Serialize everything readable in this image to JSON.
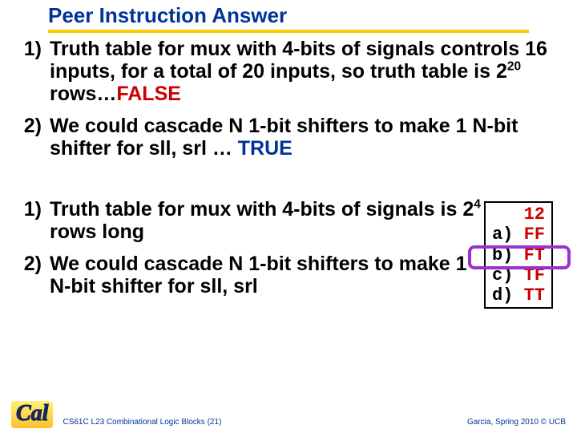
{
  "title": "Peer Instruction Answer",
  "top_bullets": [
    {
      "num": "1)",
      "pre": "Truth table for mux with 4-bits of signals controls 16 inputs, for a total of 20 inputs, so truth table is 2",
      "sup": "20",
      "post": " rows…",
      "verdict": "FALSE",
      "verdict_class": "red"
    },
    {
      "num": "2)",
      "pre": "We could cascade N 1-bit shifters to make 1 N-bit shifter for sll, srl … ",
      "sup": "",
      "post": "",
      "verdict": "TRUE",
      "verdict_class": "blue"
    }
  ],
  "lower_bullets": [
    {
      "num": "1)",
      "pre": "Truth table for mux with 4-bits of signals is 2",
      "sup": "4",
      "post": " rows long"
    },
    {
      "num": "2)",
      "pre": "We could cascade N 1-bit shifters to make 1 N-bit shifter for sll, srl",
      "sup": "",
      "post": ""
    }
  ],
  "answers": {
    "header": "   12",
    "rows": [
      {
        "label": "a)",
        "val": " FF"
      },
      {
        "label": "b)",
        "val": " FT"
      },
      {
        "label": "c)",
        "val": " TF"
      },
      {
        "label": "d)",
        "val": " TT"
      }
    ],
    "correct_index": 1
  },
  "footer": {
    "logo_text": "Cal",
    "mid": "CS61C L23 Combinational Logic Blocks (21)",
    "right": "Garcia, Spring 2010 © UCB"
  }
}
